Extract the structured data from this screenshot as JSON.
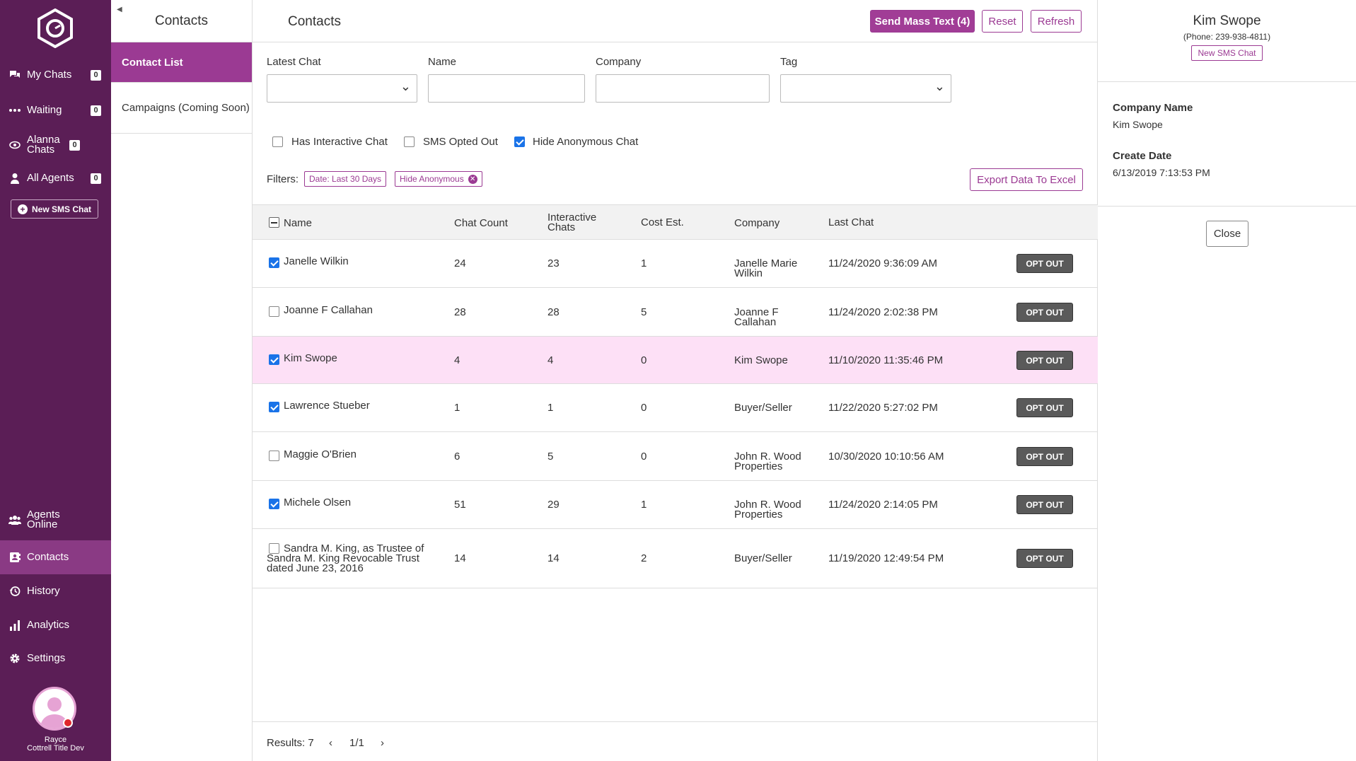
{
  "nav": {
    "items": [
      {
        "label": "My Chats",
        "count": "0",
        "icon": "chat-bubbles-icon"
      },
      {
        "label": "Waiting",
        "count": "0",
        "icon": "ellipsis-icon"
      },
      {
        "label": "Alanna Chats",
        "count": "0",
        "icon": "eye-icon"
      },
      {
        "label": "All Agents",
        "count": "0",
        "icon": "person-icon"
      }
    ],
    "new_sms": "New SMS Chat",
    "bottom": [
      {
        "label": "Agents Online",
        "icon": "users-icon"
      },
      {
        "label": "Contacts",
        "icon": "address-book-icon"
      },
      {
        "label": "History",
        "icon": "history-icon"
      },
      {
        "label": "Analytics",
        "icon": "bar-chart-icon"
      },
      {
        "label": "Settings",
        "icon": "gear-icon"
      }
    ],
    "user": {
      "name": "Rayce",
      "org": "Cottrell Title Dev"
    }
  },
  "subnav": {
    "title": "Contacts",
    "items": [
      "Contact List",
      "Campaigns (Coming Soon)"
    ]
  },
  "main": {
    "title": "Contacts",
    "buttons": {
      "mass_text": "Send Mass Text (4)",
      "reset": "Reset",
      "refresh": "Refresh",
      "export": "Export Data To Excel"
    },
    "filters": {
      "latest_chat": "Latest Chat",
      "name": "Name",
      "company": "Company",
      "tag": "Tag",
      "has_interactive": "Has Interactive Chat",
      "sms_opted_out": "SMS Opted Out",
      "hide_anonymous": "Hide Anonymous Chat",
      "filters_label": "Filters:",
      "chip_date": "Date: Last 30 Days",
      "chip_anon": "Hide Anonymous"
    },
    "columns": {
      "name": "Name",
      "chat_count": "Chat Count",
      "interactive": "Interactive Chats",
      "cost": "Cost Est.",
      "company": "Company",
      "last_chat": "Last Chat"
    },
    "rows": [
      {
        "checked": true,
        "name": "Janelle Wilkin",
        "chat_count": "24",
        "interactive": "23",
        "cost": "1",
        "company": "Janelle Marie Wilkin",
        "last_chat": "11/24/2020 9:36:09 AM",
        "action": "OPT OUT"
      },
      {
        "checked": false,
        "name": "Joanne F Callahan",
        "chat_count": "28",
        "interactive": "28",
        "cost": "5",
        "company": "Joanne F Callahan",
        "last_chat": "11/24/2020 2:02:38 PM",
        "action": "OPT OUT"
      },
      {
        "checked": true,
        "name": "Kim Swope",
        "chat_count": "4",
        "interactive": "4",
        "cost": "0",
        "company": "Kim Swope",
        "last_chat": "11/10/2020 11:35:46 PM",
        "action": "OPT OUT",
        "selected": true
      },
      {
        "checked": true,
        "name": "Lawrence Stueber",
        "chat_count": "1",
        "interactive": "1",
        "cost": "0",
        "company": "Buyer/Seller",
        "last_chat": "11/22/2020 5:27:02 PM",
        "action": "OPT OUT"
      },
      {
        "checked": false,
        "name": "Maggie O'Brien",
        "chat_count": "6",
        "interactive": "5",
        "cost": "0",
        "company": "John R. Wood Properties",
        "last_chat": "10/30/2020 10:10:56 AM",
        "action": "OPT OUT"
      },
      {
        "checked": true,
        "name": "Michele Olsen",
        "chat_count": "51",
        "interactive": "29",
        "cost": "1",
        "company": "John R. Wood Properties",
        "last_chat": "11/24/2020 2:14:05 PM",
        "action": "OPT OUT"
      },
      {
        "checked": false,
        "name": "Sandra M. King, as Trustee of Sandra M. King Revocable Trust dated June 23, 2016",
        "chat_count": "14",
        "interactive": "14",
        "cost": "2",
        "company": "Buyer/Seller",
        "last_chat": "11/19/2020 12:49:54 PM",
        "action": "OPT OUT"
      }
    ],
    "footer": {
      "results": "Results: 7",
      "prev": "‹",
      "page": "1/1",
      "next": "›"
    }
  },
  "side": {
    "name": "Kim Swope",
    "phone": "(Phone: 239-938-4811)",
    "new_sms": "New SMS Chat",
    "company_label": "Company Name",
    "company_value": "Kim Swope",
    "date_label": "Create Date",
    "date_value": "6/13/2019 7:13:53 PM",
    "close": "Close"
  },
  "colors": {
    "nav_bg": "#5b1e56",
    "accent": "#9b3a93",
    "selected_row": "#fde0f6"
  }
}
